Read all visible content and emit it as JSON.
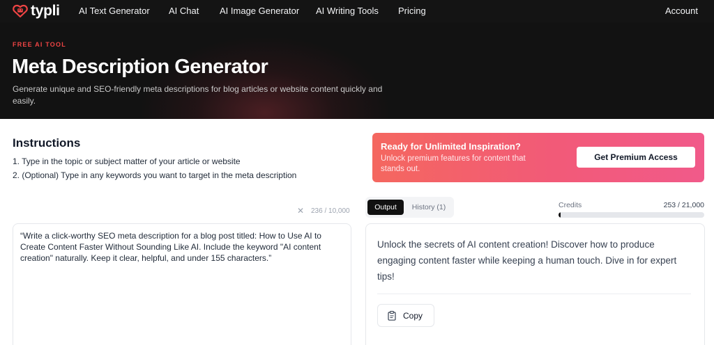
{
  "nav": {
    "brand": "typli",
    "items": [
      "AI Text Generator",
      "AI Chat",
      "AI Image Generator",
      "AI Writing Tools",
      "Pricing"
    ],
    "account": "Account"
  },
  "hero": {
    "eyebrow": "FREE AI TOOL",
    "title": "Meta Description Generator",
    "subtitle": "Generate unique and SEO-friendly meta descriptions for blog articles or website content quickly and easily."
  },
  "instructions": {
    "title": "Instructions",
    "steps": [
      "1. Type in the topic or subject matter of your article or website",
      "2. (Optional) Type in any keywords you want to target in the meta description"
    ]
  },
  "input": {
    "counter": "236 / 10,000",
    "value": "“Write a click-worthy SEO meta description for a blog post titled: How to Use AI to Create Content Faster Without Sounding Like AI. Include the keyword \"AI content creation\" naturally. Keep it clear, helpful, and under 155 characters.”"
  },
  "promo": {
    "title": "Ready for Unlimited Inspiration?",
    "subtitle": "Unlock premium features for content that stands out.",
    "button": "Get Premium Access"
  },
  "tabs": {
    "output": "Output",
    "history": "History (1)"
  },
  "credits": {
    "label": "Credits",
    "value": "253 / 21,000",
    "used_fraction": 0.012
  },
  "output": {
    "text": "Unlock the secrets of AI content creation! Discover how to produce engaging content faster while keeping a human touch. Dive in for expert tips!",
    "copy_label": "Copy"
  },
  "colors": {
    "accent": "#ef4444",
    "promo_start": "#f4675f",
    "promo_end": "#f15a8a",
    "nav_bg": "#141414"
  },
  "icons": {
    "brand": "typli-logo-icon",
    "clear": "close-icon",
    "copy": "clipboard-icon"
  }
}
